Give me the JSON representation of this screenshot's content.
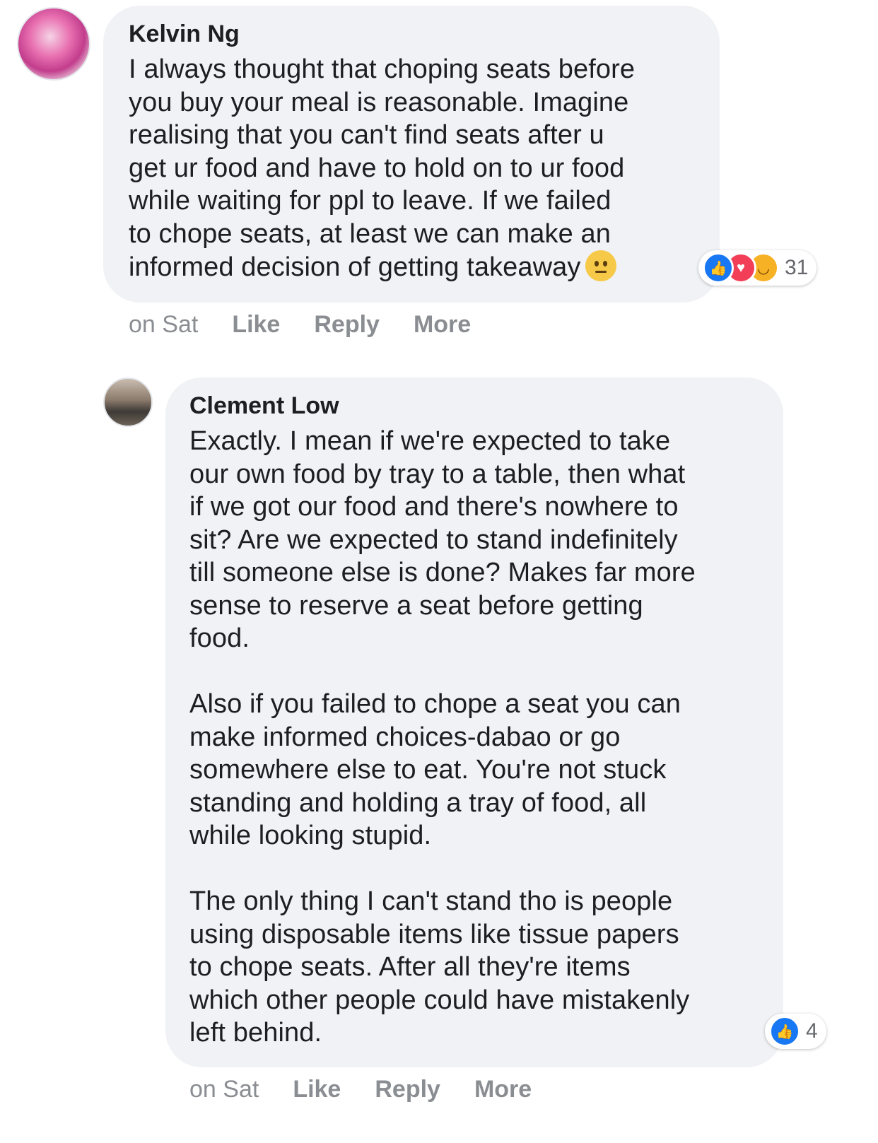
{
  "comments": [
    {
      "author": "Kelvin Ng",
      "text": "I always thought that choping seats before\nyou buy your meal is reasonable. Imagine\nrealising that you can't find seats after u\nget ur food and have to hold on to ur food\nwhile waiting for ppl to leave. If we failed\nto chope seats, at least we can make an\ninformed decision of getting takeaway",
      "emoji": "neutral-face",
      "time": "on Sat",
      "like_label": "Like",
      "reply_label": "Reply",
      "more_label": "More",
      "reaction_count": "31",
      "reactions": [
        "like",
        "love",
        "haha"
      ],
      "colors": {
        "like": "#1877f2",
        "love": "#f33e58",
        "haha": "#f7b125"
      }
    },
    {
      "author": "Clement Low",
      "text": "Exactly. I mean if we're expected to take\nour own food by tray to a table, then what\nif we got our food and there's nowhere to\nsit? Are we expected to stand indefinitely\ntill someone else is done? Makes far more\nsense to reserve a seat before getting\nfood.\n\nAlso if you failed to chope a seat you can\nmake informed choices-dabao or go\nsomewhere else to eat. You're not stuck\nstanding and holding a tray of food, all\nwhile looking stupid.\n\nThe only thing I can't stand tho is people\nusing disposable items like tissue papers\nto chope seats. After all they're items\nwhich other people could have mistakenly\nleft behind.",
      "time": "on Sat",
      "like_label": "Like",
      "reply_label": "Reply",
      "more_label": "More",
      "reaction_count": "4",
      "reactions": [
        "like"
      ]
    }
  ]
}
